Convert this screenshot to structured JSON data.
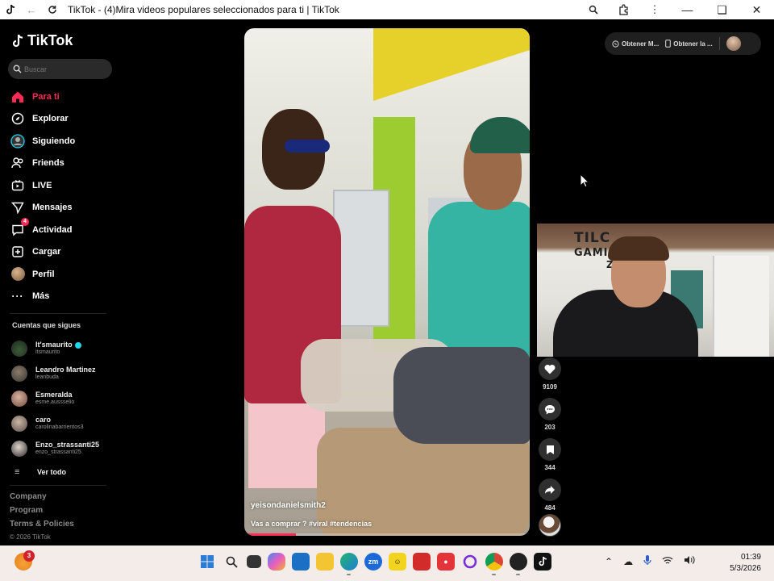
{
  "browser": {
    "title": "TikTok - (4)Mira videos populares seleccionados para ti | TikTok"
  },
  "sidebar": {
    "logo": "TikTok",
    "search_placeholder": "Buscar",
    "nav": [
      {
        "label": "Para ti",
        "icon": "home-icon",
        "active": true
      },
      {
        "label": "Explorar",
        "icon": "compass-icon"
      },
      {
        "label": "Siguiendo",
        "icon": "following-icon"
      },
      {
        "label": "Friends",
        "icon": "friends-icon"
      },
      {
        "label": "LIVE",
        "icon": "live-icon"
      },
      {
        "label": "Mensajes",
        "icon": "messages-icon"
      },
      {
        "label": "Actividad",
        "icon": "activity-icon",
        "badge": "4"
      },
      {
        "label": "Cargar",
        "icon": "upload-icon"
      },
      {
        "label": "Perfil",
        "icon": "profile-avatar"
      },
      {
        "label": "Más",
        "icon": "more-icon"
      }
    ],
    "following_title": "Cuentas que sigues",
    "following": [
      {
        "name": "It'smaurito",
        "handle": "itsmaurito",
        "verified": true
      },
      {
        "name": "Leandro Martinez",
        "handle": "leanbuda"
      },
      {
        "name": "Esmeralda",
        "handle": "esme.aussselio"
      },
      {
        "name": "caro",
        "handle": "carolinabarrientos3"
      },
      {
        "name": "Enzo_strassanti25",
        "handle": "enzo_strassanti25"
      }
    ],
    "see_all": "Ver todo",
    "footer": [
      "Company",
      "Program",
      "Terms & Policies"
    ],
    "copyright": "© 2026 TikTok"
  },
  "video": {
    "username": "yeisondanielsmith2",
    "caption": "Vas a comprar ? #viral #tendencias",
    "progress": 0.18
  },
  "actions": {
    "likes": "9109",
    "comments": "203",
    "saves": "344",
    "shares": "484"
  },
  "top_pill": {
    "item1": "Obtener M...",
    "item2": "Obtener la ..."
  },
  "webcam": {
    "sign_line1": "TILC",
    "sign_line2": "GAMIN",
    "sign_line3": "ZO"
  },
  "taskbar": {
    "weather_badge": "3",
    "time": "01:39",
    "date": "5/3/2026"
  }
}
